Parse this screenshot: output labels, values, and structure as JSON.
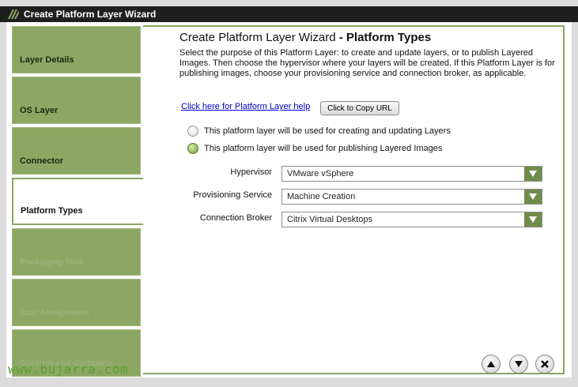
{
  "window": {
    "title": "Create Platform Layer Wizard"
  },
  "nav": {
    "items": [
      {
        "label": "Layer Details",
        "state": "enabled"
      },
      {
        "label": "OS Layer",
        "state": "enabled"
      },
      {
        "label": "Connector",
        "state": "enabled"
      },
      {
        "label": "Platform Types",
        "state": "active"
      },
      {
        "label": "Packaging Disk",
        "state": "disabled"
      },
      {
        "label": "Icon Assignment",
        "state": "disabled"
      },
      {
        "label": "Confirm and Complete",
        "state": "disabled"
      }
    ]
  },
  "main": {
    "heading_prefix": "Create Platform Layer Wizard",
    "heading_suffix": "- Platform Types",
    "description": "Select the purpose of this Platform Layer: to create and update layers, or to publish Layered Images. Then choose the hypervisor where your layers will be created. If this Platform Layer is for publishing images, choose your provisioning service and connection broker, as applicable.",
    "help_link": "Click here for Platform Layer help",
    "copy_url_button": "Click to Copy URL",
    "radio_options": [
      {
        "label": "This platform layer will be used for creating and updating Layers",
        "checked": false
      },
      {
        "label": "This platform layer will be used for publishing Layered Images",
        "checked": true
      }
    ],
    "fields": {
      "hypervisor": {
        "label": "Hypervisor",
        "value": "VMware vSphere"
      },
      "provisioning": {
        "label": "Provisioning Service",
        "value": "Machine Creation"
      },
      "broker": {
        "label": "Connection Broker",
        "value": "Citrix Virtual Desktops"
      }
    }
  },
  "colors": {
    "accent": "#8ba763",
    "dropdown_arrow": "#6f8c49",
    "link": "#0000cc",
    "titlebar": "#1f1f1f"
  },
  "watermark": "www.bujarra.com"
}
